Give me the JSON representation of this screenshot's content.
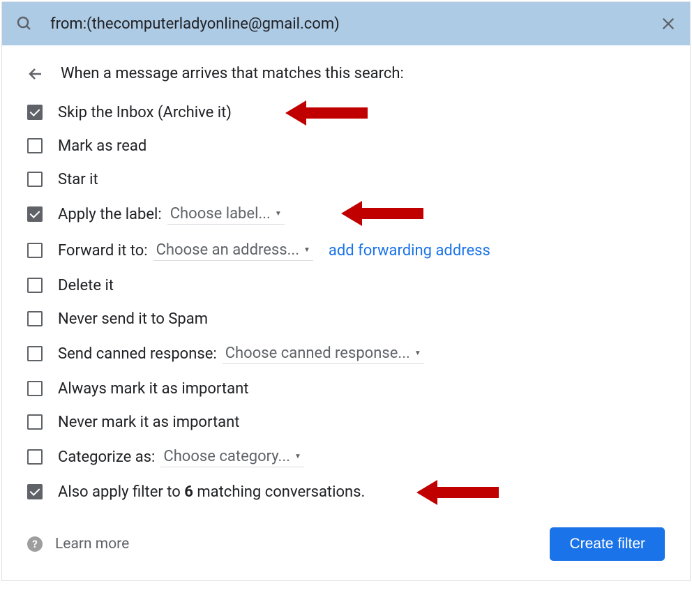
{
  "search": {
    "query": "from:(thecomputerladyonline@gmail.com)"
  },
  "header": {
    "title": "When a message arrives that matches this search:"
  },
  "options": [
    {
      "id": "skip-inbox",
      "label": "Skip the Inbox (Archive it)",
      "checked": true,
      "arrow": true
    },
    {
      "id": "mark-read",
      "label": "Mark as read",
      "checked": false
    },
    {
      "id": "star-it",
      "label": "Star it",
      "checked": false
    },
    {
      "id": "apply-label",
      "label": "Apply the label:",
      "checked": true,
      "dropdown": "Choose label...",
      "arrow": true
    },
    {
      "id": "forward-to",
      "label": "Forward it to:",
      "checked": false,
      "dropdown": "Choose an address...",
      "link": "add forwarding address"
    },
    {
      "id": "delete-it",
      "label": "Delete it",
      "checked": false
    },
    {
      "id": "never-spam",
      "label": "Never send it to Spam",
      "checked": false
    },
    {
      "id": "canned-response",
      "label": "Send canned response:",
      "checked": false,
      "dropdown": "Choose canned response..."
    },
    {
      "id": "always-important",
      "label": "Always mark it as important",
      "checked": false
    },
    {
      "id": "never-important",
      "label": "Never mark it as important",
      "checked": false
    },
    {
      "id": "categorize-as",
      "label": "Categorize as:",
      "checked": false,
      "dropdown": "Choose category..."
    },
    {
      "id": "also-apply",
      "label_pre": "Also apply filter to ",
      "label_bold": "6",
      "label_post": " matching conversations.",
      "checked": true,
      "arrow": true
    }
  ],
  "footer": {
    "learn_more": "Learn more",
    "create_button": "Create filter"
  },
  "colors": {
    "search_bg": "#aecbe6",
    "primary": "#1a73e8",
    "arrow": "#c00000"
  }
}
